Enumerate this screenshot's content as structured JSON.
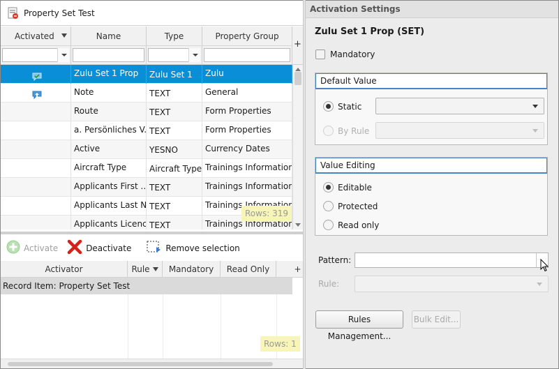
{
  "window": {
    "title": "Property Set Test"
  },
  "grid": {
    "columns": [
      "Activated",
      "Name",
      "Type",
      "Property Group"
    ],
    "add_column": "+",
    "rows": [
      {
        "name": "Zulu Set 1 Prop",
        "type": "Zulu Set 1",
        "group": "Zulu",
        "icon": "speech-bubble-check-icon",
        "selected": true
      },
      {
        "name": "Note",
        "type": "TEXT",
        "group": "General",
        "icon": "speech-bubble-up-icon",
        "selected": false
      },
      {
        "name": "Route",
        "type": "TEXT",
        "group": "Form Properties",
        "icon": "",
        "selected": false
      },
      {
        "name": "a. Persönliches V...",
        "type": "TEXT",
        "group": "Form Properties",
        "icon": "",
        "selected": false
      },
      {
        "name": "Active",
        "type": "YESNO",
        "group": "Currency Dates",
        "icon": "",
        "selected": false
      },
      {
        "name": "Aircraft Type",
        "type": "Aircraft Type",
        "group": "Trainings Information",
        "icon": "",
        "selected": false
      },
      {
        "name": "Applicants First ...",
        "type": "TEXT",
        "group": "Trainings Information",
        "icon": "",
        "selected": false
      },
      {
        "name": "Applicants Last N...",
        "type": "TEXT",
        "group": "Trainings Information",
        "icon": "",
        "selected": false
      },
      {
        "name": "Applicants Licenc...",
        "type": "TEXT",
        "group": "Trainings Information",
        "icon": "",
        "selected": false
      }
    ],
    "row_count": "Rows: 319"
  },
  "toolbar": {
    "activate": "Activate",
    "deactivate": "Deactivate",
    "remove_selection": "Remove selection"
  },
  "activators": {
    "columns": [
      "Activator",
      "Rule",
      "Mandatory",
      "Read Only"
    ],
    "add_column": "+",
    "rows": [
      {
        "activator": "Record Item: Property Set Test"
      }
    ],
    "row_count": "Rows: 1"
  },
  "settings": {
    "header": "Activation Settings",
    "title": "Zulu Set 1 Prop (SET)",
    "mandatory_label": "Mandatory",
    "default_value": {
      "legend": "Default Value",
      "static": "Static",
      "by_rule": "By Rule"
    },
    "value_editing": {
      "legend": "Value Editing",
      "editable": "Editable",
      "protected": "Protected",
      "read_only": "Read only",
      "selected": "Editable"
    },
    "pattern_label": "Pattern:",
    "rule_label": "Rule:",
    "rules_management": "Rules Management...",
    "bulk_edit": "Bulk Edit..."
  },
  "colors": {
    "selection": "#0a8ed8",
    "rowcount_bg": "#f7f5b7",
    "accent_border": "#4a83c4"
  }
}
